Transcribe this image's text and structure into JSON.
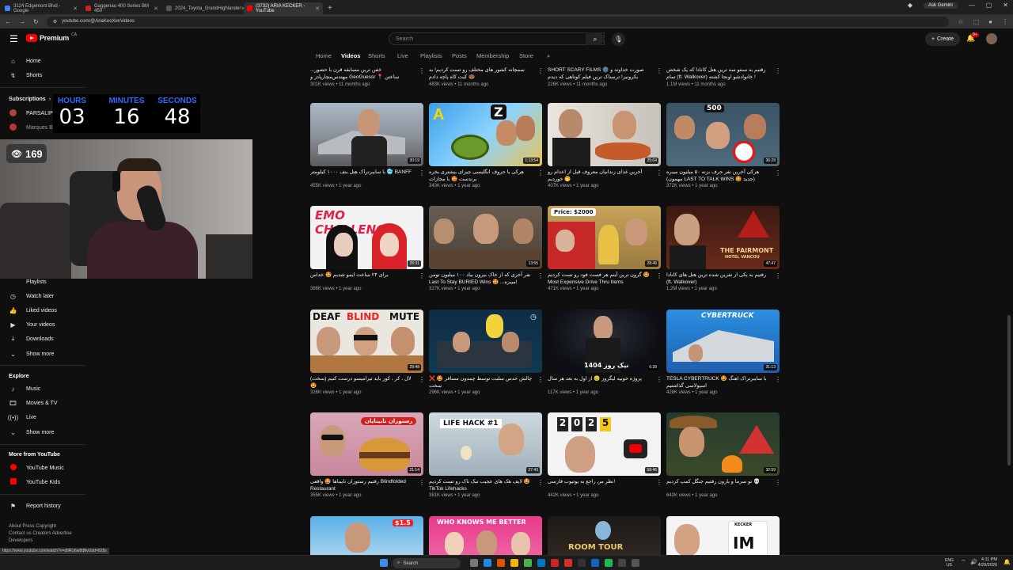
{
  "browser": {
    "tabs": [
      {
        "label": "3124 Edgemont Blvd - Google",
        "color": "#4285f4",
        "active": false
      },
      {
        "label": "Gaggenau 400 Series BM 450",
        "color": "#cc2222",
        "active": false
      },
      {
        "label": "2024_Toyota_GrandHighlander",
        "color": "#555555",
        "active": false
      },
      {
        "label": "(3732) ARIA KECKER - YouTube",
        "color": "#ff0000",
        "active": true
      }
    ],
    "url": "youtube.com/@AriaKeoXer/videos",
    "gemini": "Ask Gemini",
    "status_url": "https://www.youtube.com/watch?v=d9RU6w8tBtvUdd=828s"
  },
  "header": {
    "logo_text": "Premium",
    "logo_region": "CA",
    "search_placeholder": "Search",
    "create_label": "Create",
    "notif_count": "9+"
  },
  "sidebar": {
    "home": "Home",
    "shorts": "Shorts",
    "subscriptions": "Subscriptions",
    "subs": [
      "PARSALIP",
      "Marques Brownl..."
    ],
    "you_items": [
      "Playlists",
      "Watch later",
      "Liked videos",
      "Your videos",
      "Downloads",
      "Show more"
    ],
    "explore_title": "Explore",
    "explore_items": [
      "Music",
      "Movies & TV",
      "Live",
      "Show more"
    ],
    "more_title": "More from YouTube",
    "more_items": [
      "YouTube Music",
      "YouTube Kids"
    ],
    "report": "Report history",
    "footer": [
      "About  Press  Copyright",
      "Contact us  Creators  Advertise",
      "Developers"
    ]
  },
  "channel_nav": [
    "Home",
    "Videos",
    "Shorts",
    "Live",
    "Playlists",
    "Posts",
    "Membership",
    "Store"
  ],
  "timer": {
    "hours_label": "HOURS",
    "minutes_label": "MINUTES",
    "seconds_label": "SECONDS",
    "hours": "03",
    "minutes": "16",
    "seconds": "48"
  },
  "viewer_count": "169",
  "top_row": [
    {
      "title": "...خفن ترین مسابقه قرن با حضور مهندس‌مچارپادز و GeoGuessr 📍 ساعتن",
      "meta": "301K views • 11 months ago"
    },
    {
      "title": "سمچانه کشور های مختلف رو تست کردیم! به کیت کاه پاچه دادم 🍩",
      "meta": "483K views • 11 months ago"
    },
    {
      "title": "SHORT SCARY FILMS 🌚 صورت خداوند و بکرونیز! ترسناک ترین فیلم کوتاهی که دیدم",
      "meta": "226K views • 11 months ago"
    },
    {
      "title": "رفتیم به سنتو سه ترین هتل کانادا که یک شخص تمام (ft. Walkover) خانوادشو اونجا کشته !",
      "meta": "1.1M views • 11 months ago"
    }
  ],
  "videos": [
    {
      "title": "با سایبرتراک هتل بنف ۱۰۰۰ کیلومتر 🥶 BANFF",
      "meta": "455K views • 1 year ago",
      "duration": "30:19"
    },
    {
      "title": "هرکی با حروف انگلیسی چیزای بیشتری بخره برندست 🤩 با مجازات",
      "meta": "343K views • 1 year ago",
      "duration": "1:13:54"
    },
    {
      "title": "آخرین غذای زندانیان معروف قبل از اعدام رو خوردیم 🤭",
      "meta": "407K views • 1 year ago",
      "duration": "25:04"
    },
    {
      "title": "هرکی آخرین نفر حرف بزنه ۵۰ میلیون میبره (مهمون LAST TO TALK WINS 🤩 جدید)",
      "meta": "372K views • 1 year ago",
      "duration": "36:29"
    },
    {
      "title": "برای ۲۴ ساعت ایمو شدیم 🤩 خداس",
      "meta": "386K views • 1 year ago",
      "duration": "26:31"
    },
    {
      "title": "نفر آخری که از خاک بیرون بیاد ۱۰۰ میلیون تومن Last To Stay BURIED Wins 🤩 ...میبره!",
      "meta": "327K views • 1 year ago",
      "duration": "13:55"
    },
    {
      "title": "گرون ترین آیتم هر فست فود رو تست کردیم 🤩 Most Expensive Drive Thru Items",
      "meta": "471K views • 1 year ago",
      "duration": "28:46"
    },
    {
      "title": "رفتیم به یکی از نفرین شده ترین هتل های کانادا (ft. Walkover)",
      "meta": "1.2M views • 1 year ago",
      "duration": "47:47"
    },
    {
      "title": "لال ، کر ، کور باید تیرامیسو درست کنیم (سخت) 🤩",
      "meta": "326K views • 1 year ago",
      "duration": "29:48"
    },
    {
      "title": "چالش حدس سلبت توسط چمدون مسافر 🤩 ❌ سخت",
      "meta": "296K views • 1 year ago",
      "duration": ""
    },
    {
      "title": "پروژه خوبیه لیگروز 😊 از اول به بعد هر سال",
      "meta": "117K views • 1 year ago",
      "duration": "6:39"
    },
    {
      "title": "TESLA CYBERTRUCK با سایبرتراک اهنگ 🤩 اسپولاسی گذاشتیم",
      "meta": "428K views • 1 year ago",
      "duration": "31:13"
    },
    {
      "title": "رفتیم رستوران نابیناها 🤩 واقعی Blindfolded Restaurant",
      "meta": "355K views • 1 year ago",
      "duration": "21:14"
    },
    {
      "title": "لایف هک های عجیب تیک تاک رو تست کردیم 🤩 TikTok Lifehacks",
      "meta": "381K views • 1 year ago",
      "duration": "27:43"
    },
    {
      "title": "نظر من راجع به یوتیوب فارسی!",
      "meta": "442K views • 1 year ago",
      "duration": "58:46"
    },
    {
      "title": "تو سرما و بارون رفتیم جنگل کمپ کردیم 💀",
      "meta": "642K views • 1 year ago",
      "duration": "32:59"
    }
  ],
  "thumb_texts": {
    "t2": "Z",
    "t4": "500",
    "t5": "EMO CHALLENGE",
    "t7": "Price: $2000",
    "t8a": "THE FAIRMONT",
    "t8b": "HOTEL VANCOU",
    "t9a": "DEAF",
    "t9b": "BLIND",
    "t9c": "MUTE",
    "t11": "نیک روز 1404",
    "t12": "CYBERTRUCK",
    "t13": "رستوران نابینایان",
    "t14": "LIFE HACK #1",
    "t15a": "2",
    "t15b": "0",
    "t15c": "2",
    "t15d": "5",
    "b2": "WHO KNOWS ME BETTER",
    "b1": "$1.5",
    "b3": "ROOM TOUR",
    "b4a": "KECKER",
    "b4b": "IM"
  },
  "taskbar": {
    "search": "Search",
    "lang1": "ENG",
    "lang2": "US",
    "time": "4:11 PM",
    "date": "4/29/2026"
  }
}
